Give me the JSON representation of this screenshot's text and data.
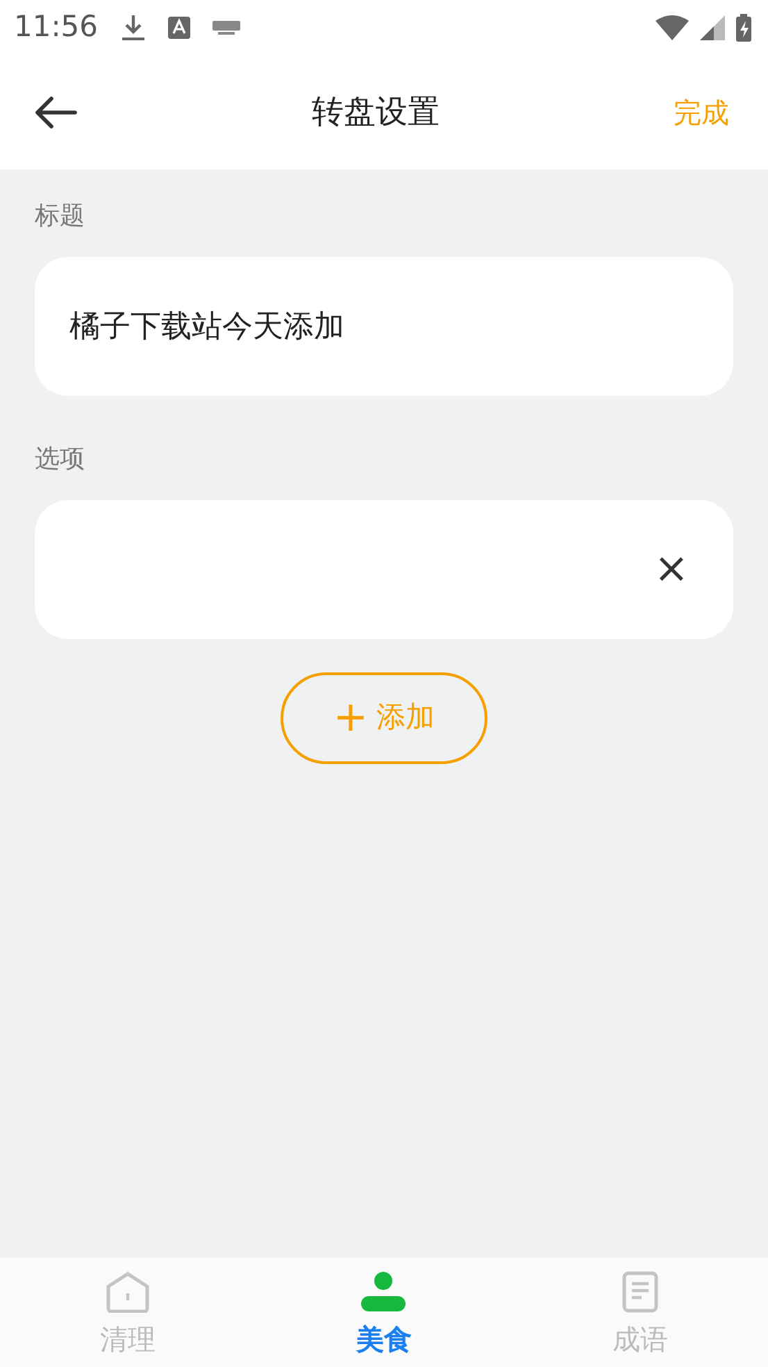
{
  "status_bar": {
    "time": "11:56"
  },
  "header": {
    "title": "转盘设置",
    "action": "完成"
  },
  "title_section": {
    "label": "标题",
    "value": "橘子下载站今天添加"
  },
  "options_section": {
    "label": "选项",
    "options": [
      {
        "remove": "×"
      }
    ]
  },
  "add_button": {
    "icon": "+",
    "label": "添加"
  },
  "tab_bar": [
    {
      "label": "清理",
      "kind": "home",
      "selected": false
    },
    {
      "label": "美食",
      "kind": "person",
      "selected": true
    },
    {
      "label": "成语",
      "kind": "doc",
      "selected": false
    }
  ]
}
